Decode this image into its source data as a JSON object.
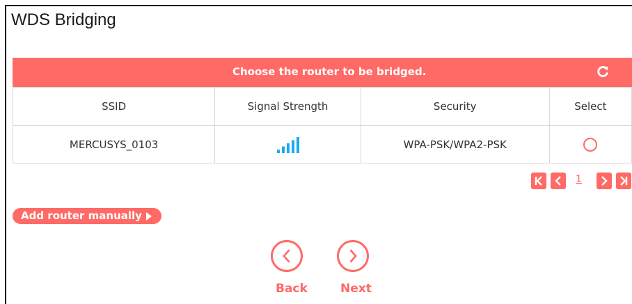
{
  "page": {
    "title": "WDS Bridging"
  },
  "panel": {
    "header": "Choose the router to be bridged.",
    "refresh_icon": "refresh-icon"
  },
  "table": {
    "columns": [
      "SSID",
      "Signal Strength",
      "Security",
      "Select"
    ],
    "rows": [
      {
        "ssid": "MERCUSYS_0103",
        "signal_bars": 5,
        "signal_max_bars": 5,
        "security": "WPA-PSK/WPA2-PSK",
        "selected": false
      }
    ]
  },
  "pagination": {
    "current_page": "1",
    "icons": [
      "first-page-icon",
      "prev-page-icon",
      "next-page-icon",
      "last-page-icon"
    ]
  },
  "actions": {
    "add_manually": "Add router manually",
    "back": "Back",
    "next": "Next"
  },
  "colors": {
    "accent": "#ff6a66",
    "border": "#d9d9d9",
    "signal": "#1aaaf0"
  }
}
